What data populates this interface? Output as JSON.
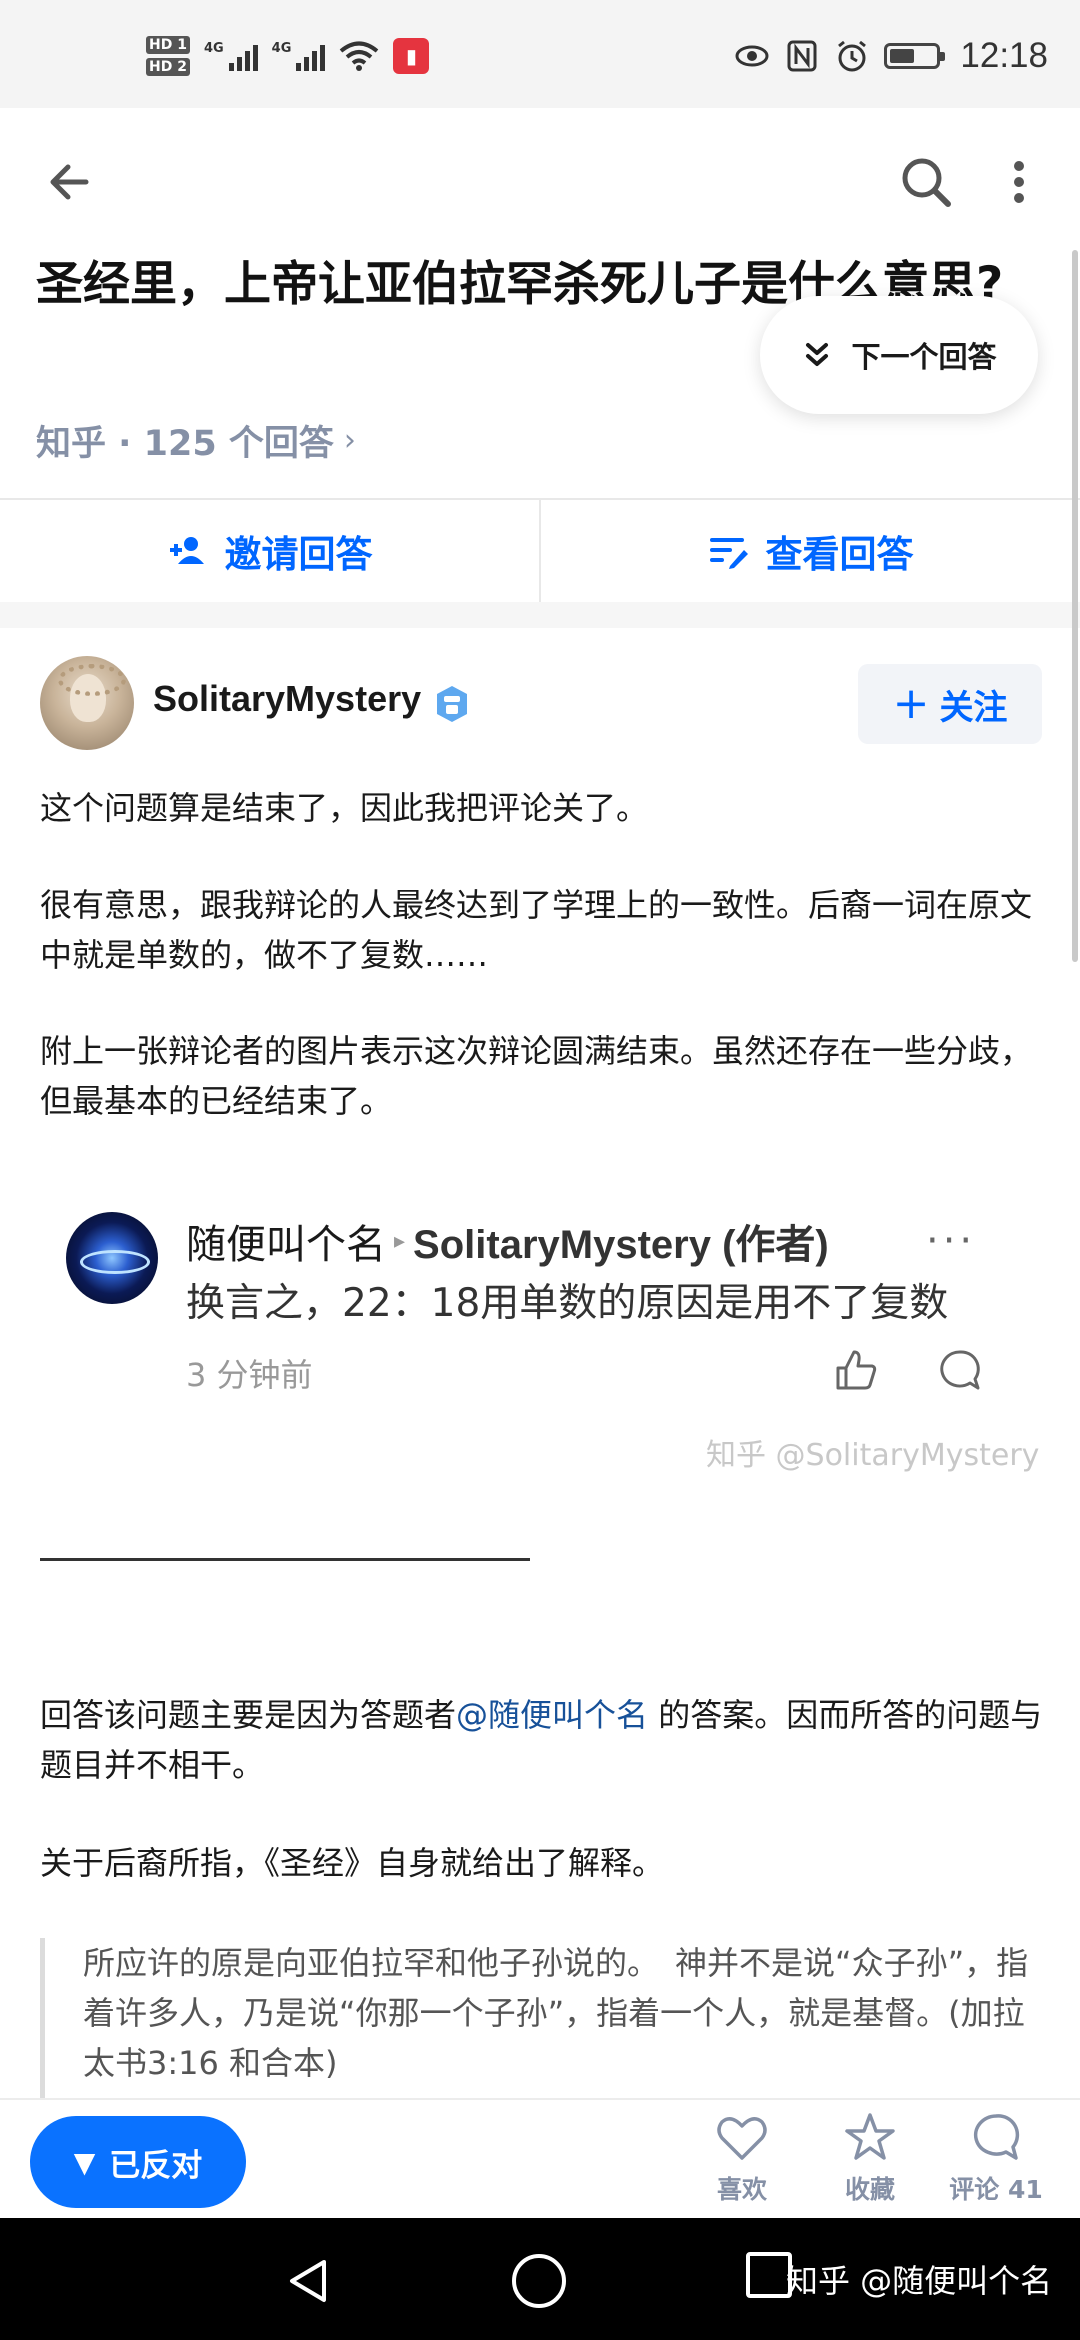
{
  "status_bar": {
    "hd1": "HD 1",
    "hd2": "HD 2",
    "net1": "4G",
    "net2": "4G",
    "time": "12:18",
    "battery_level": 0.55
  },
  "question": {
    "title": "圣经里，上帝让亚伯拉罕杀死儿子是什么意思?",
    "meta": "知乎 · 125 个回答",
    "next_answer_label": "下一个回答"
  },
  "actions": {
    "invite_label": "邀请回答",
    "view_label": "查看回答"
  },
  "author": {
    "name": "SolitaryMystery",
    "follow_label": "关注"
  },
  "answer": {
    "p1": "这个问题算是结束了，因此我把评论关了。",
    "p2": "很有意思，跟我辩论的人最终达到了学理上的一致性。后裔一词在原文中就是单数的，做不了复数……",
    "p3": "附上一张辩论者的图片表示这次辩论圆满结束。虽然还存在一些分歧，但最基本的已经结束了。",
    "comment": {
      "from": "随便叫个名",
      "to": "SolitaryMystery (作者)",
      "more": "···",
      "body": "换言之，22：18用单数的原因是用不了复数",
      "time": "3 分钟前"
    },
    "watermark": "知乎 @SolitaryMystery",
    "p4_before": "回答该问题主要是因为答题者",
    "p4_mention": "@随便叫个名",
    "p4_after": " 的答案。因而所答的问题与题目并不相干。",
    "p5": "关于后裔所指，《圣经》自身就给出了解释。",
    "quote": "所应许的原是向亚伯拉罕和他子孙说的。　神并不是说“众子孙”，指着许多人，乃是说“你那一个子孙”，指着一个人，就是基督。(加拉太书3:16 和合本)"
  },
  "bottom_bar": {
    "reaction_label": "已反对",
    "like_label": "喜欢",
    "collect_label": "收藏",
    "comment_label": "评论 41"
  },
  "nav": {
    "watermark": "知乎 @随便叫个名"
  },
  "colors": {
    "brand_blue": "#0066ff",
    "reaction_blue": "#0a72ff",
    "meta_gray": "#8590a6",
    "mention_blue": "#175199"
  },
  "icons": [
    "back-arrow-icon",
    "search-icon",
    "more-vertical-icon",
    "chevron-double-down-icon",
    "add-user-icon",
    "list-edit-icon",
    "verified-badge-icon",
    "thumb-up-icon",
    "reply-bubble-icon",
    "heart-icon",
    "star-icon",
    "comment-icon",
    "triangle-down-icon"
  ]
}
